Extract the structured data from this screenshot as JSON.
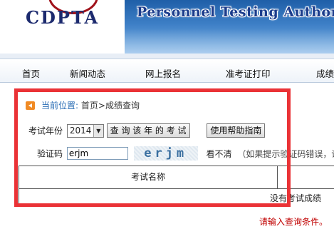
{
  "header": {
    "logo_text": "CDPTA",
    "tagline": "Personnel Testing Authorities"
  },
  "nav": {
    "items": [
      {
        "label": "首页"
      },
      {
        "label": "新闻动态"
      },
      {
        "label": "网上报名"
      },
      {
        "label": "准考证打印"
      },
      {
        "label": "成绩"
      }
    ]
  },
  "breadcrumb": {
    "label": "当前位置:",
    "home": "首页",
    "separator": ">",
    "current": "成绩查询"
  },
  "form": {
    "year_label": "考试年份",
    "year_value": "2014",
    "query_button": "查 询 该 年 的 考 试",
    "help_button": "使用帮助指南",
    "captcha_label": "验证码",
    "captcha_value": "erjm",
    "captcha_image_text": "erjm",
    "unclear_link": "看不清",
    "hint_text": "（如果提示验证码错误，请重"
  },
  "table": {
    "column_header": "考试名称",
    "empty_text": "没有考试成绩"
  },
  "message": "请输入查询条件。",
  "colors": {
    "highlight_border": "#ea3236",
    "nav_bg": "#eef3f9",
    "banner": "#1f5fa8",
    "error_text": "#c00000"
  }
}
